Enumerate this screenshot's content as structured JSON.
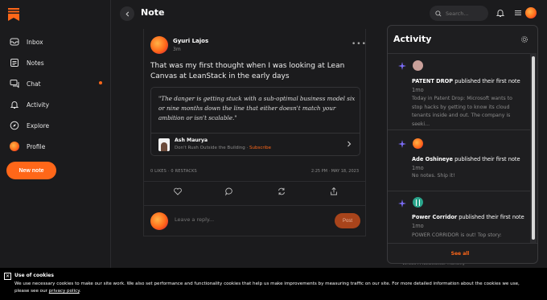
{
  "sidebar": {
    "items": [
      {
        "label": "Inbox",
        "icon": "inbox-icon"
      },
      {
        "label": "Notes",
        "icon": "notes-icon"
      },
      {
        "label": "Chat",
        "icon": "chat-icon",
        "unread": true
      },
      {
        "label": "Activity",
        "icon": "bell-icon"
      },
      {
        "label": "Explore",
        "icon": "compass-icon"
      },
      {
        "label": "Profile",
        "icon": "avatar"
      }
    ],
    "new_note_label": "New note"
  },
  "header": {
    "title": "Note",
    "search_placeholder": "Search..."
  },
  "note": {
    "author": "Gyuri Lajos",
    "time": "3m",
    "text": "That was my first thought when I was looking at Lean Canvas  at LeanStack in the early days",
    "quote": {
      "text": "\"The danger is getting stuck with a sub-optimal business model six or nine months down the line that either doesn't match your ambition or isn't scalable.\"",
      "author": "Ash Maurya",
      "book": "Don't Rush Outside the Building",
      "subscribe": "Subscribe",
      "separator": " · "
    },
    "stats": "0 LIKES · 0 RESTACKS",
    "date": "2:25 PM · MAY 18, 2023",
    "reply_placeholder": "Leave a reply...",
    "post_label": "Post"
  },
  "activity": {
    "title": "Activity",
    "items": [
      {
        "name": "PATENT DROP",
        "action": " published their first note ",
        "time": "1mo",
        "body": "Today in Patent Drop: Microsoft wants to stop hacks by getting to know its cloud tenants inside and out. The company is seeki...",
        "avatar_color": "#c9a09a"
      },
      {
        "name": "Ade Oshineye",
        "action": " published their first note ",
        "time": "1mo",
        "body": "No notes. Ship it!",
        "avatar_color": "#ff6719"
      },
      {
        "name": "Power Corridor",
        "action": " published their first note ",
        "time": "1mo",
        "body": "POWER CORRIDOR is out! Top story:",
        "avatar_color": "#2aa58c"
      }
    ],
    "see_all": "See all"
  },
  "peek_text": "Writes A Newsletter Monthly",
  "cookie": {
    "title": "Use of cookies",
    "text": "We use necessary cookies to make our site work. We also set performance and functionality cookies that help us make improvements by measuring traffic on our site. For more detailed information about the cookies we use, please see our ",
    "link": "privacy policy",
    "end": "."
  },
  "colors": {
    "accent": "#ff6719",
    "background": "#1b1b1d"
  }
}
